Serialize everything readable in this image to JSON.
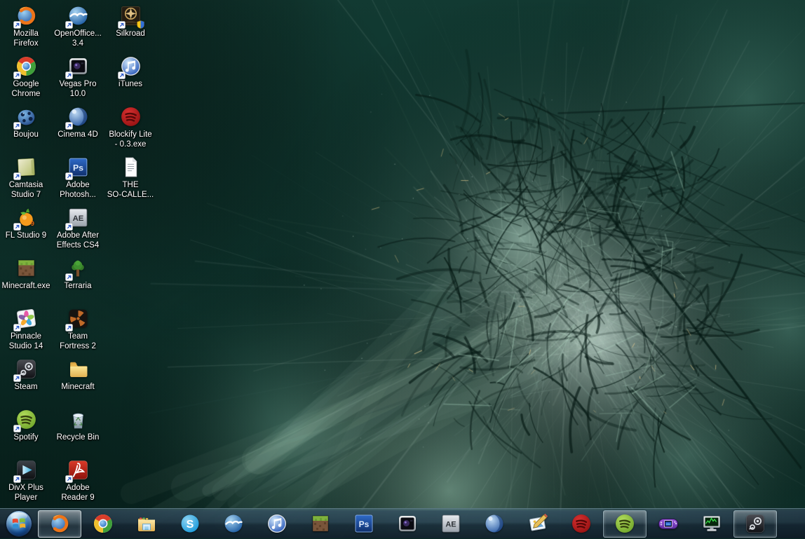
{
  "desktop": {
    "wallpaper": {
      "description": "abstract teal-green shatter burst",
      "base_dark": "#0a2a24",
      "base_mid": "#123a32",
      "highlight_mint": "#d8f2e4",
      "shard_dark": "#051815",
      "gold_glint": "#eed08e"
    },
    "icons": [
      {
        "name": "mozilla-firefox",
        "label": "Mozilla\nFirefox",
        "icon": "firefox-icon",
        "col": 0,
        "row": 0,
        "shortcut": true,
        "shield": false
      },
      {
        "name": "openoffice",
        "label": "OpenOffice...\n3.4",
        "icon": "openoffice-icon",
        "col": 1,
        "row": 0,
        "shortcut": true,
        "shield": false
      },
      {
        "name": "silkroad",
        "label": "Silkroad",
        "icon": "silkroad-icon",
        "col": 2,
        "row": 0,
        "shortcut": true,
        "shield": true
      },
      {
        "name": "google-chrome",
        "label": "Google\nChrome",
        "icon": "chrome-icon",
        "col": 0,
        "row": 1,
        "shortcut": true,
        "shield": false
      },
      {
        "name": "vegas-pro",
        "label": "Vegas Pro\n10.0",
        "icon": "vegas-icon",
        "col": 1,
        "row": 1,
        "shortcut": true,
        "shield": false
      },
      {
        "name": "itunes",
        "label": "iTunes",
        "icon": "itunes-icon",
        "col": 2,
        "row": 1,
        "shortcut": true,
        "shield": false
      },
      {
        "name": "boujou",
        "label": "Boujou",
        "icon": "boujou-icon",
        "col": 0,
        "row": 2,
        "shortcut": true,
        "shield": false
      },
      {
        "name": "cinema-4d",
        "label": "Cinema 4D",
        "icon": "cinema4d-icon",
        "col": 1,
        "row": 2,
        "shortcut": true,
        "shield": false
      },
      {
        "name": "blockify-lite",
        "label": "Blockify Lite\n- 0.3.exe",
        "icon": "spotify-red-icon",
        "col": 2,
        "row": 2,
        "shortcut": false,
        "shield": false
      },
      {
        "name": "camtasia-studio",
        "label": "Camtasia\nStudio 7",
        "icon": "camtasia-icon",
        "col": 0,
        "row": 3,
        "shortcut": true,
        "shield": false
      },
      {
        "name": "adobe-photoshop",
        "label": "Adobe\nPhotosh...",
        "icon": "photoshop-icon",
        "col": 1,
        "row": 3,
        "shortcut": true,
        "shield": false
      },
      {
        "name": "the-so-called-doc",
        "label": "THE\nSO-CALLE...",
        "icon": "text-document-icon",
        "col": 2,
        "row": 3,
        "shortcut": false,
        "shield": false
      },
      {
        "name": "fl-studio",
        "label": "FL Studio 9",
        "icon": "flstudio-icon",
        "col": 0,
        "row": 4,
        "shortcut": true,
        "shield": false
      },
      {
        "name": "after-effects",
        "label": "Adobe After\nEffects CS4",
        "icon": "aftereffects-icon",
        "col": 1,
        "row": 4,
        "shortcut": true,
        "shield": false
      },
      {
        "name": "minecraft-exe",
        "label": "Minecraft.exe",
        "icon": "minecraft-icon",
        "col": 0,
        "row": 5,
        "shortcut": false,
        "shield": false
      },
      {
        "name": "terraria",
        "label": "Terraria",
        "icon": "terraria-icon",
        "col": 1,
        "row": 5,
        "shortcut": true,
        "shield": false
      },
      {
        "name": "pinnacle-studio",
        "label": "Pinnacle\nStudio 14",
        "icon": "pinnacle-icon",
        "col": 0,
        "row": 6,
        "shortcut": true,
        "shield": false
      },
      {
        "name": "team-fortress-2",
        "label": "Team\nFortress 2",
        "icon": "tf2-icon",
        "col": 1,
        "row": 6,
        "shortcut": true,
        "shield": false
      },
      {
        "name": "steam",
        "label": "Steam",
        "icon": "steam-icon",
        "col": 0,
        "row": 7,
        "shortcut": true,
        "shield": false
      },
      {
        "name": "minecraft-folder",
        "label": "Minecraft",
        "icon": "folder-icon",
        "col": 1,
        "row": 7,
        "shortcut": false,
        "shield": false
      },
      {
        "name": "spotify",
        "label": "Spotify",
        "icon": "spotify-green-icon",
        "col": 0,
        "row": 8,
        "shortcut": true,
        "shield": false
      },
      {
        "name": "recycle-bin",
        "label": "Recycle Bin",
        "icon": "recycle-bin-icon",
        "col": 1,
        "row": 8,
        "shortcut": false,
        "shield": false
      },
      {
        "name": "divx-plus-player",
        "label": "DivX Plus\nPlayer",
        "icon": "divx-icon",
        "col": 0,
        "row": 9,
        "shortcut": true,
        "shield": false
      },
      {
        "name": "adobe-reader",
        "label": "Adobe\nReader 9",
        "icon": "adobe-reader-icon",
        "col": 1,
        "row": 9,
        "shortcut": true,
        "shield": false
      }
    ]
  },
  "taskbar": {
    "start_button": {
      "name": "start",
      "icon": "windows-orb-icon"
    },
    "buttons": [
      {
        "name": "firefox",
        "icon": "firefox-icon",
        "state": "active"
      },
      {
        "name": "chrome",
        "icon": "chrome-icon",
        "state": "pinned"
      },
      {
        "name": "windows-explorer",
        "icon": "explorer-folder-icon",
        "state": "pinned"
      },
      {
        "name": "skype",
        "icon": "skype-icon",
        "state": "pinned"
      },
      {
        "name": "openoffice",
        "icon": "openoffice-icon",
        "state": "pinned"
      },
      {
        "name": "itunes",
        "icon": "itunes-icon",
        "state": "pinned"
      },
      {
        "name": "minecraft",
        "icon": "minecraft-icon",
        "state": "pinned"
      },
      {
        "name": "photoshop",
        "icon": "photoshop-icon",
        "state": "pinned"
      },
      {
        "name": "vegas-pro",
        "icon": "vegas-icon",
        "state": "pinned"
      },
      {
        "name": "after-effects",
        "icon": "aftereffects-icon",
        "state": "pinned"
      },
      {
        "name": "cinema-4d",
        "icon": "cinema4d-icon",
        "state": "pinned"
      },
      {
        "name": "paint-editor",
        "icon": "paint-editor-icon",
        "state": "pinned"
      },
      {
        "name": "blockify",
        "icon": "spotify-red-icon",
        "state": "pinned"
      },
      {
        "name": "spotify",
        "icon": "spotify-green-icon",
        "state": "running"
      },
      {
        "name": "vba-emulator",
        "icon": "gba-emulator-icon",
        "state": "pinned"
      },
      {
        "name": "task-manager",
        "icon": "task-manager-icon",
        "state": "pinned"
      },
      {
        "name": "steam",
        "icon": "steam-icon",
        "state": "running"
      }
    ],
    "colors": {
      "glass_top": "#51707e",
      "glass_bottom": "#16242e",
      "active_border": "#cfe6ee"
    }
  }
}
